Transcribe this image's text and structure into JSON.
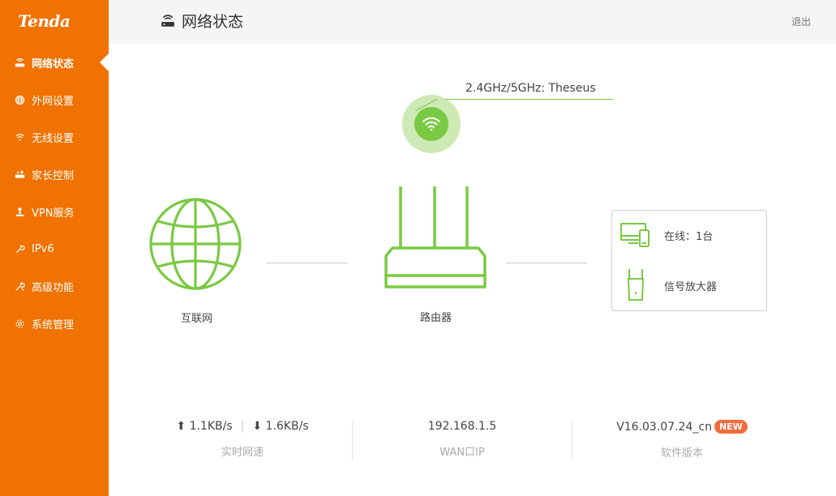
{
  "brand": {
    "logo_text": "Tenda",
    "accent_color": "#f07200",
    "green": "#7ac943"
  },
  "sidebar": {
    "items": [
      {
        "label": "网络状态",
        "icon": "router-icon",
        "active": true
      },
      {
        "label": "外网设置",
        "icon": "globe-icon",
        "active": false
      },
      {
        "label": "无线设置",
        "icon": "wifi-icon",
        "active": false
      },
      {
        "label": "家长控制",
        "icon": "parental-control-icon",
        "active": false
      },
      {
        "label": "VPN服务",
        "icon": "vpn-icon",
        "active": false
      },
      {
        "label": "IPv6",
        "icon": "wrench-icon",
        "active": false
      },
      {
        "label": "高级功能",
        "icon": "tools-icon",
        "active": false
      },
      {
        "label": "系统管理",
        "icon": "gear-icon",
        "active": false
      }
    ]
  },
  "header": {
    "title": "网络状态",
    "logout_label": "退出"
  },
  "diagram": {
    "ssid": "2.4GHz/5GHz: Theseus",
    "internet_label": "互联网",
    "router_label": "路由器",
    "devices": {
      "online_label": "在线：1台",
      "extender_label": "信号放大器"
    }
  },
  "stats": {
    "upload": "1.1KB/s",
    "separator": "|",
    "download": "1.6KB/s",
    "speed_caption": "实时网速",
    "wan_ip": "192.168.1.5",
    "wan_caption": "WAN口IP",
    "version": "V16.03.07.24_cn",
    "version_badge": "NEW",
    "version_caption": "软件版本"
  }
}
